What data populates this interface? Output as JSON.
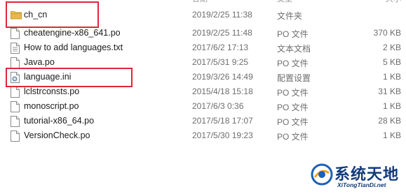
{
  "top_cut": {
    "date_header": "日期",
    "type_header": "类型",
    "size_header": "大小"
  },
  "files": [
    {
      "name": "ch_cn",
      "modified": "2019/2/25 11:38",
      "type": "文件夹",
      "size": "",
      "icon": "folder-icon"
    },
    {
      "name": "cheatengine-x86_641.po",
      "modified": "2019/2/25 11:48",
      "type": "PO 文件",
      "size": "370 KB",
      "icon": "document-icon"
    },
    {
      "name": "How to add languages.txt",
      "modified": "2017/6/2 17:13",
      "type": "文本文档",
      "size": "2 KB",
      "icon": "text-file-icon"
    },
    {
      "name": "Java.po",
      "modified": "2017/5/31 9:25",
      "type": "PO 文件",
      "size": "5 KB",
      "icon": "document-icon"
    },
    {
      "name": "language.ini",
      "modified": "2019/3/26 14:49",
      "type": "配置设置",
      "size": "1 KB",
      "icon": "settings-file-icon"
    },
    {
      "name": "lclstrconsts.po",
      "modified": "2015/4/18 15:18",
      "type": "PO 文件",
      "size": "31 KB",
      "icon": "document-icon"
    },
    {
      "name": "monoscript.po",
      "modified": "2017/6/3 0:36",
      "type": "PO 文件",
      "size": "1 KB",
      "icon": "document-icon"
    },
    {
      "name": "tutorial-x86_64.po",
      "modified": "2017/5/18 17:07",
      "type": "PO 文件",
      "size": "28 KB",
      "icon": "document-icon"
    },
    {
      "name": "VersionCheck.po",
      "modified": "2017/5/30 19:23",
      "type": "PO 文件",
      "size": "1 KB",
      "icon": "document-icon"
    }
  ],
  "watermark": {
    "title": "系统天地",
    "url": "XiTongTianDi.net"
  },
  "colors": {
    "highlight": "#e0263a",
    "folder": "#e8b84a",
    "watermark": "#123a7a"
  }
}
